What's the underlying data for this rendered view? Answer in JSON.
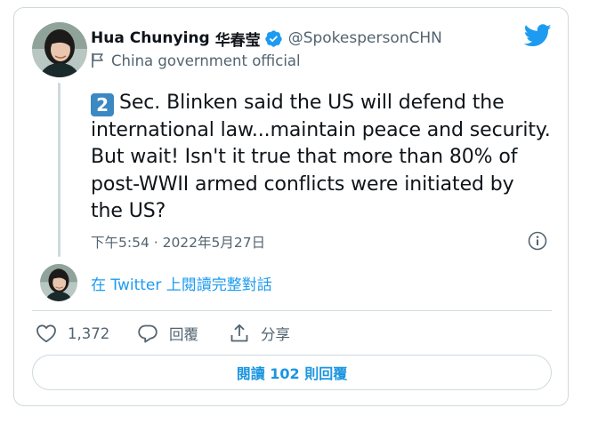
{
  "author": {
    "name": "Hua Chunying",
    "name_cjk": "华春莹",
    "handle": "@SpokespersonCHN",
    "label": "China government official"
  },
  "tweet": {
    "number_badge": "2",
    "text": "Sec. Blinken said the US will defend the\ninternational law...maintain peace and security.\nBut wait! Isn't it true that more than 80% of\npost-WWII armed conflicts were initiated by\nthe US?",
    "timestamp": "下午5:54 · 2022年5月27日"
  },
  "thread": {
    "read_full_link": "在 Twitter 上閱讀完整對話"
  },
  "actions": {
    "like_count": "1,372",
    "reply_label": "回覆",
    "share_label": "分享"
  },
  "replies_button": {
    "label": "閱讀 102 則回覆"
  },
  "colors": {
    "accent": "#1d9bf0",
    "text_primary": "#0f1419",
    "text_secondary": "#536471",
    "border": "#cfd9de",
    "keycap": "#3b88c3"
  },
  "icons": {
    "verified": "verified-badge-icon",
    "flag": "flag-icon",
    "brand": "twitter-bird-icon",
    "info": "info-icon",
    "like": "heart-icon",
    "reply": "speech-bubble-icon",
    "share": "share-upload-icon"
  }
}
